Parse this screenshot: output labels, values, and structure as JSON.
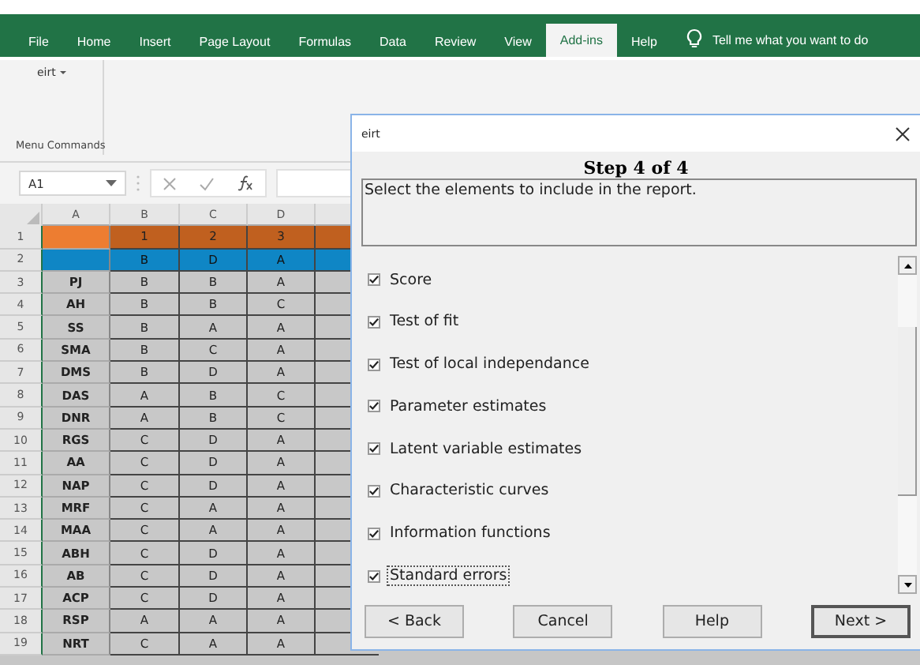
{
  "ribbon": {
    "tabs": [
      {
        "label": "File",
        "selected": false
      },
      {
        "label": "Home",
        "selected": false
      },
      {
        "label": "Insert",
        "selected": false
      },
      {
        "label": "Page Layout",
        "selected": false
      },
      {
        "label": "Formulas",
        "selected": false
      },
      {
        "label": "Data",
        "selected": false
      },
      {
        "label": "Review",
        "selected": false
      },
      {
        "label": "View",
        "selected": false
      },
      {
        "label": "Add-ins",
        "selected": true
      },
      {
        "label": "Help",
        "selected": false
      }
    ],
    "tell_me": "Tell me what you want to do",
    "group": {
      "button": "eirt",
      "label": "Menu Commands"
    }
  },
  "formula_bar": {
    "name_box": "A1"
  },
  "sheet": {
    "columns": [
      "A",
      "B",
      "C",
      "D"
    ],
    "rows": [
      {
        "number": "1",
        "kind": "numbers",
        "cells": [
          "",
          "1",
          "2",
          "3"
        ]
      },
      {
        "number": "2",
        "kind": "key",
        "cells": [
          "",
          "B",
          "D",
          "A"
        ]
      },
      {
        "number": "3",
        "kind": "data",
        "cells": [
          "PJ",
          "B",
          "B",
          "A"
        ]
      },
      {
        "number": "4",
        "kind": "data",
        "cells": [
          "AH",
          "B",
          "B",
          "C"
        ]
      },
      {
        "number": "5",
        "kind": "data",
        "cells": [
          "SS",
          "B",
          "A",
          "A"
        ]
      },
      {
        "number": "6",
        "kind": "data",
        "cells": [
          "SMA",
          "B",
          "C",
          "A"
        ]
      },
      {
        "number": "7",
        "kind": "data",
        "cells": [
          "DMS",
          "B",
          "D",
          "A"
        ]
      },
      {
        "number": "8",
        "kind": "data",
        "cells": [
          "DAS",
          "A",
          "B",
          "C"
        ]
      },
      {
        "number": "9",
        "kind": "data",
        "cells": [
          "DNR",
          "A",
          "B",
          "C"
        ]
      },
      {
        "number": "10",
        "kind": "data",
        "cells": [
          "RGS",
          "C",
          "D",
          "A"
        ]
      },
      {
        "number": "11",
        "kind": "data",
        "cells": [
          "AA",
          "C",
          "D",
          "A"
        ]
      },
      {
        "number": "12",
        "kind": "data",
        "cells": [
          "NAP",
          "C",
          "D",
          "A"
        ]
      },
      {
        "number": "13",
        "kind": "data",
        "cells": [
          "MRF",
          "C",
          "A",
          "A"
        ]
      },
      {
        "number": "14",
        "kind": "data",
        "cells": [
          "MAA",
          "C",
          "A",
          "A"
        ]
      },
      {
        "number": "15",
        "kind": "data",
        "cells": [
          "ABH",
          "C",
          "D",
          "A"
        ]
      },
      {
        "number": "16",
        "kind": "data",
        "cells": [
          "AB",
          "C",
          "D",
          "A"
        ]
      },
      {
        "number": "17",
        "kind": "data",
        "cells": [
          "ACP",
          "C",
          "D",
          "A"
        ]
      },
      {
        "number": "18",
        "kind": "data",
        "cells": [
          "RSP",
          "A",
          "A",
          "A"
        ]
      },
      {
        "number": "19",
        "kind": "data",
        "cells": [
          "NRT",
          "C",
          "A",
          "A"
        ]
      }
    ]
  },
  "dialog": {
    "title": "eirt",
    "step": "Step 4 of 4",
    "description": "Select the elements to include in the report.",
    "options": [
      {
        "label": "Score",
        "checked": true,
        "focused": false
      },
      {
        "label": "Test of fit",
        "checked": true,
        "focused": false
      },
      {
        "label": "Test of local independance",
        "checked": true,
        "focused": false
      },
      {
        "label": "Parameter estimates",
        "checked": true,
        "focused": false
      },
      {
        "label": "Latent variable estimates",
        "checked": true,
        "focused": false
      },
      {
        "label": "Characteristic curves",
        "checked": true,
        "focused": false
      },
      {
        "label": "Information functions",
        "checked": true,
        "focused": false
      },
      {
        "label": "Standard errors",
        "checked": true,
        "focused": true
      }
    ],
    "buttons": [
      {
        "label": "< Back",
        "default": false
      },
      {
        "label": "Cancel",
        "default": false
      },
      {
        "label": "Help",
        "default": false
      },
      {
        "label": "Next >",
        "default": true
      }
    ]
  }
}
